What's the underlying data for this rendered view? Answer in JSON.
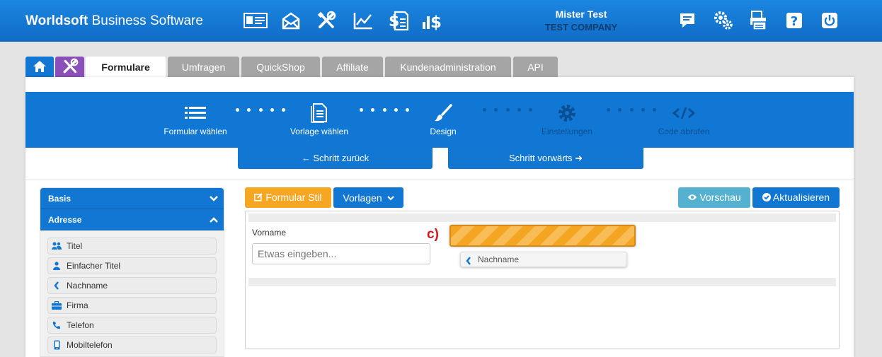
{
  "header": {
    "brand_bold": "Worldsoft",
    "brand_rest": " Business Software",
    "user_name": "Mister Test",
    "company": "TEST COMPANY",
    "nav_icons": [
      "contact-card-icon",
      "mail-icon",
      "tools-icon",
      "chart-icon",
      "invoice-dollar-icon",
      "bar-dollar-icon"
    ],
    "util_icons": [
      "chat-icon",
      "gears-icon",
      "printer-icon",
      "help-icon",
      "power-icon"
    ]
  },
  "tabs": [
    {
      "label": "Formulare",
      "active": true
    },
    {
      "label": "Umfragen"
    },
    {
      "label": "QuickShop"
    },
    {
      "label": "Affiliate"
    },
    {
      "label": "Kundenadministration"
    },
    {
      "label": "API"
    }
  ],
  "wizard": {
    "steps": [
      {
        "label": "Formular wählen",
        "icon": "list-icon",
        "active": true
      },
      {
        "label": "Vorlage wählen",
        "icon": "document-icon",
        "active": true
      },
      {
        "label": "Design",
        "icon": "brush-icon",
        "active": true
      },
      {
        "label": "Einstellungen",
        "icon": "gear-icon",
        "active": false
      },
      {
        "label": "Code abrufen",
        "icon": "code-icon",
        "active": false
      }
    ],
    "back_label": "← Schritt zurück",
    "next_label": "Schritt vorwärts ➜"
  },
  "sidebar": {
    "sections": [
      "Basis",
      "Adresse"
    ],
    "items": [
      {
        "label": "Titel",
        "icon": "users-icon"
      },
      {
        "label": "Einfacher Titel",
        "icon": "user-icon"
      },
      {
        "label": "Nachname",
        "icon": "chevron-left-icon"
      },
      {
        "label": "Firma",
        "icon": "briefcase-icon"
      },
      {
        "label": "Telefon",
        "icon": "phone-icon"
      },
      {
        "label": "Mobiltelefon",
        "icon": "mobile-icon"
      }
    ]
  },
  "toolbar": {
    "style_label": "Formular Stil",
    "templates_label": "Vorlagen",
    "preview_label": "Vorschau",
    "refresh_label": "Aktualisieren",
    "colors": {
      "orange": "#f5a623",
      "blue": "#1277d2",
      "teal": "#55b1cf"
    }
  },
  "editor": {
    "field_label": "Vorname",
    "field_placeholder": "Etwas eingeben...",
    "annotation": "c)",
    "dragging_label": "Nachname"
  }
}
